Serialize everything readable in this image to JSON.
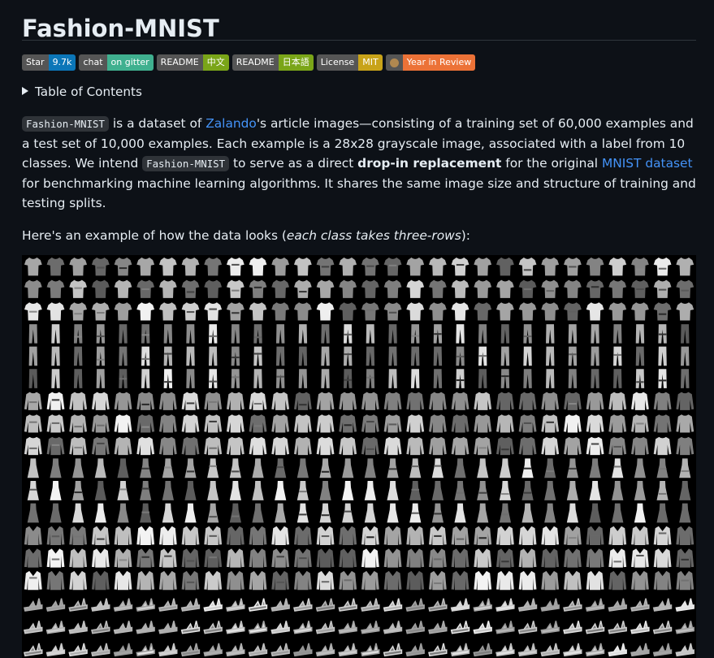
{
  "title": "Fashion-MNIST",
  "badges": [
    {
      "left": "Star",
      "right": "9.7k",
      "color": "#0b76b8"
    },
    {
      "left": "chat",
      "right": "on gitter",
      "color": "#3fb08f"
    },
    {
      "left": "README",
      "right": "中文",
      "color": "#7aa518"
    },
    {
      "left": "README",
      "right": "日本語",
      "color": "#7aa518"
    },
    {
      "left": "License",
      "right": "MIT",
      "color": "#c8a319"
    },
    {
      "left": "",
      "right": "Year in Review",
      "color": "#ec7237",
      "icon": "avatar-icon"
    }
  ],
  "toc": {
    "label": "Table of Contents"
  },
  "intro": {
    "code1": "Fashion-MNIST",
    "t1": " is a dataset of ",
    "link_zalando": "Zalando",
    "t2": "'s article images—consisting of a training set of 60,000 examples and a test set of 10,000 examples. Each example is a 28x28 grayscale image, associated with a label from 10 classes. We intend ",
    "code2": "Fashion-MNIST",
    "t3": " to serve as a direct ",
    "bold": "drop-in replacement",
    "t4": " for the original ",
    "link_mnist": "MNIST dataset",
    "t5": " for benchmarking machine learning algorithms. It shares the same image size and structure of training and testing splits."
  },
  "example": {
    "t1": "Here's an example of how the data looks (",
    "em": "each class takes three-rows",
    "t2": "):"
  },
  "sprite": {
    "classes": [
      "t-shirt",
      "t-shirt",
      "t-shirt",
      "trouser",
      "trouser",
      "trouser",
      "pullover",
      "pullover",
      "pullover",
      "dress",
      "dress",
      "dress",
      "coat",
      "coat",
      "coat",
      "sandal",
      "sandal",
      "sandal"
    ],
    "icon": "fashion-mnist-sprite"
  }
}
